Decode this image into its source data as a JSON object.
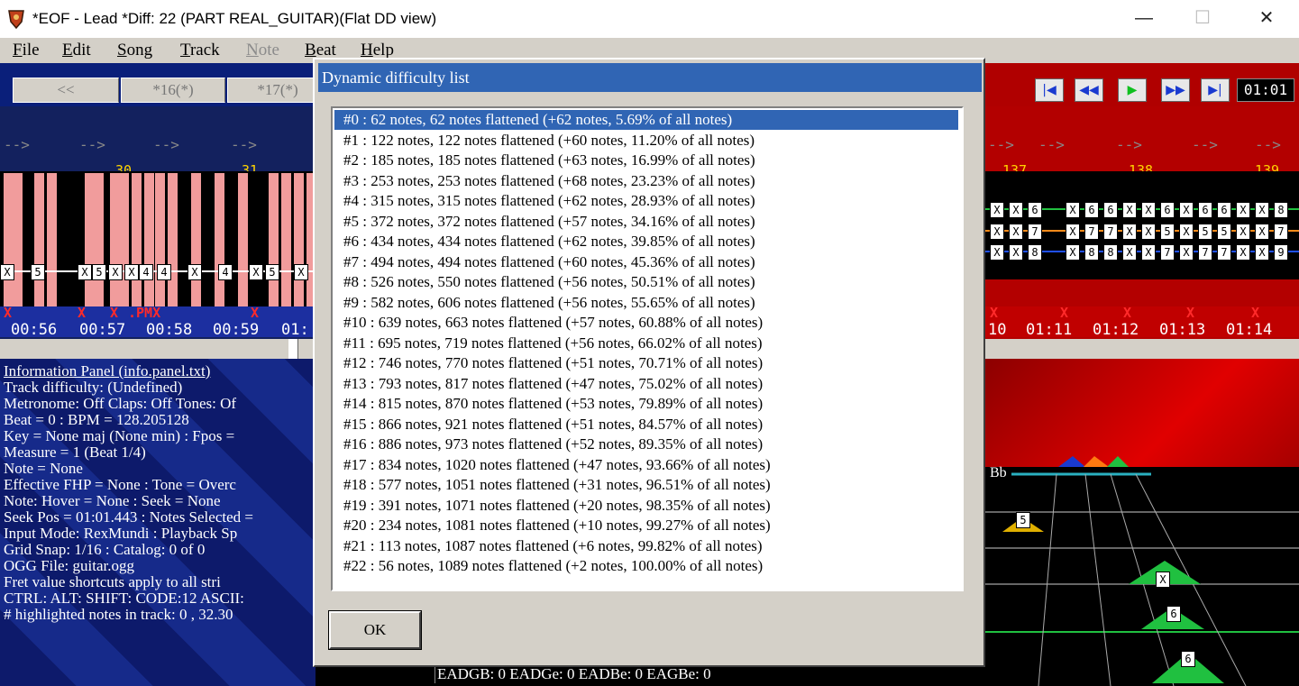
{
  "window": {
    "title": "*EOF - Lead  *Diff: 22 (PART REAL_GUITAR)(Flat DD view)",
    "minimize_glyph": "—",
    "maximize_glyph": "☐",
    "close_glyph": "✕"
  },
  "menu": [
    {
      "label": "File",
      "ul": "F",
      "rest": "ile",
      "disabled": false
    },
    {
      "label": "Edit",
      "ul": "E",
      "rest": "dit",
      "disabled": false
    },
    {
      "label": "Song",
      "ul": "S",
      "rest": "ong",
      "disabled": false
    },
    {
      "label": "Track",
      "ul": "T",
      "rest": "rack",
      "disabled": false
    },
    {
      "label": "Note",
      "ul": "N",
      "rest": "ote",
      "disabled": true
    },
    {
      "label": "Beat",
      "ul": "B",
      "rest": "eat",
      "disabled": false
    },
    {
      "label": "Help",
      "ul": "H",
      "rest": "elp",
      "disabled": false
    }
  ],
  "tabs": [
    "<<",
    "*16(*)",
    "*17(*)"
  ],
  "transport": {
    "buttons": [
      "rewind-to-start",
      "rewind",
      "play",
      "fast-forward",
      "seek-end"
    ],
    "glyphs": [
      "|◀",
      "◀◀",
      "▶",
      "▶▶",
      "▶|"
    ],
    "clock": "01:01"
  },
  "roll_left": {
    "measures": [
      "30",
      "31"
    ],
    "times": [
      "00:56",
      "00:57",
      "00:58",
      "00:59",
      "01:"
    ],
    "arrow": "-->",
    "pmx": ".PMX"
  },
  "roll_right": {
    "measures": [
      "137",
      "138",
      "139"
    ],
    "times": [
      "10",
      "01:11",
      "01:12",
      "01:13",
      "01:14"
    ]
  },
  "info_panel": {
    "lines": [
      "Information Panel (info.panel.txt)",
      "Track difficulty: (Undefined)",
      "Metronome: Off Claps: Off Tones: Of",
      "Beat = 0 : BPM = 128.205128",
      "Key = None maj (None min) : Fpos =",
      "Measure = 1 (Beat 1/4)",
      "Note = None",
      "Effective FHP = None : Tone = Overc",
      "Note: Hover = None : Seek = None",
      "Seek Pos = 01:01.443 : Notes Selected =",
      "Input Mode: RexMundi : Playback Sp",
      "Grid Snap: 1/16 : Catalog: 0 of 0",
      "OGG File: guitar.ogg",
      "Fret value shortcuts apply to all stri",
      "CTRL:  ALT:  SHIFT:  CODE:12 ASCII:",
      "# highlighted notes in track: 0 , 32.30"
    ]
  },
  "status_bar": "EADGB: 0 EADGe: 0 EADBe: 0 EAGBe: 0",
  "view3d": {
    "note_letter": "Bb",
    "fret_labels": [
      "5",
      "X",
      "6",
      "6"
    ]
  },
  "dialog": {
    "title": "Dynamic difficulty list",
    "ok_label": "OK",
    "selected_index": 0,
    "items": [
      "#0 : 62 notes, 62 notes flattened (+62 notes, 5.69% of all notes)",
      "#1 : 122 notes, 122 notes flattened (+60 notes, 11.20% of all notes)",
      "#2 : 185 notes, 185 notes flattened (+63 notes, 16.99% of all notes)",
      "#3 : 253 notes, 253 notes flattened (+68 notes, 23.23% of all notes)",
      "#4 : 315 notes, 315 notes flattened (+62 notes, 28.93% of all notes)",
      "#5 : 372 notes, 372 notes flattened (+57 notes, 34.16% of all notes)",
      "#6 : 434 notes, 434 notes flattened (+62 notes, 39.85% of all notes)",
      "#7 : 494 notes, 494 notes flattened (+60 notes, 45.36% of all notes)",
      "#8 : 526 notes, 550 notes flattened (+56 notes, 50.51% of all notes)",
      "#9 : 582 notes, 606 notes flattened (+56 notes, 55.65% of all notes)",
      "#10 : 639 notes, 663 notes flattened (+57 notes, 60.88% of all notes)",
      "#11 : 695 notes, 719 notes flattened (+56 notes, 66.02% of all notes)",
      "#12 : 746 notes, 770 notes flattened (+51 notes, 70.71% of all notes)",
      "#13 : 793 notes, 817 notes flattened (+47 notes, 75.02% of all notes)",
      "#14 : 815 notes, 870 notes flattened (+53 notes, 79.89% of all notes)",
      "#15 : 866 notes, 921 notes flattened (+51 notes, 84.57% of all notes)",
      "#16 : 886 notes, 973 notes flattened (+52 notes, 89.35% of all notes)",
      "#17 : 834 notes, 1020 notes flattened (+47 notes, 93.66% of all notes)",
      "#18 : 577 notes, 1051 notes flattened (+31 notes, 96.51% of all notes)",
      "#19 : 391 notes, 1071 notes flattened (+20 notes, 98.35% of all notes)",
      "#20 : 234 notes, 1081 notes flattened (+10 notes, 99.27% of all notes)",
      "#21 : 113 notes, 1087 notes flattened (+6 notes, 99.82% of all notes)",
      "#22 : 56 notes, 1089 notes flattened (+2 notes, 100.00% of all notes)"
    ]
  },
  "colors": {
    "selection": "#3065b4",
    "dialog_bg": "#d4d0c8",
    "roll_left_bg": "#13215e",
    "roll_right_bg": "#b30000",
    "note_pink": "#f19c9c"
  }
}
